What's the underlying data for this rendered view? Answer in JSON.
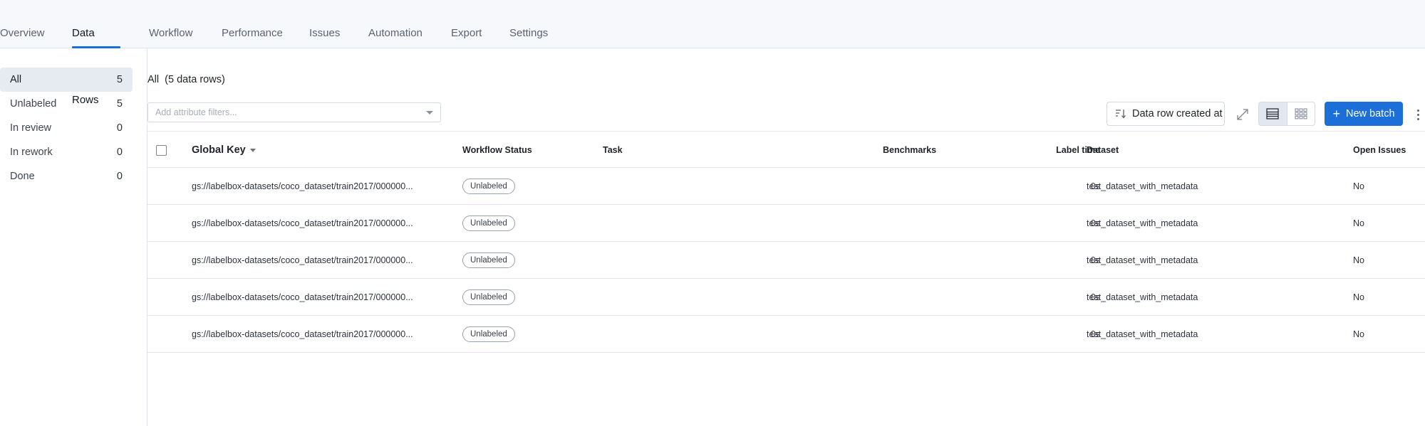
{
  "tabs": [
    {
      "label": "Overview",
      "active": false
    },
    {
      "label": "Data Rows",
      "active": true
    },
    {
      "label": "Workflow",
      "active": false
    },
    {
      "label": "Performance",
      "active": false
    },
    {
      "label": "Issues",
      "active": false
    },
    {
      "label": "Automation",
      "active": false
    },
    {
      "label": "Export",
      "active": false
    },
    {
      "label": "Settings",
      "active": false
    }
  ],
  "sidebar": {
    "items": [
      {
        "label": "All",
        "count": "5",
        "active": true
      },
      {
        "label": "Unlabeled",
        "count": "5",
        "active": false
      },
      {
        "label": "In review",
        "count": "0",
        "active": false
      },
      {
        "label": "In rework",
        "count": "0",
        "active": false
      },
      {
        "label": "Done",
        "count": "0",
        "active": false
      }
    ]
  },
  "main": {
    "heading": "All  (5 data rows)",
    "filter_placeholder": "Add attribute filters...",
    "sort_label": "Data row created at",
    "new_batch_label": "New batch"
  },
  "table": {
    "headers": {
      "global_key": "Global Key",
      "workflow_status": "Workflow Status",
      "task": "Task",
      "benchmarks": "Benchmarks",
      "label_time": "Label time",
      "dataset": "Dataset",
      "open_issues": "Open Issues"
    },
    "rows": [
      {
        "global_key": "gs://labelbox-datasets/coco_dataset/train2017/000000...",
        "status": "Unlabeled",
        "task": "",
        "benchmarks": "",
        "label_time": "0s",
        "dataset": "test_dataset_with_metadata",
        "open_issues": "No"
      },
      {
        "global_key": "gs://labelbox-datasets/coco_dataset/train2017/000000...",
        "status": "Unlabeled",
        "task": "",
        "benchmarks": "",
        "label_time": "0s",
        "dataset": "test_dataset_with_metadata",
        "open_issues": "No"
      },
      {
        "global_key": "gs://labelbox-datasets/coco_dataset/train2017/000000...",
        "status": "Unlabeled",
        "task": "",
        "benchmarks": "",
        "label_time": "0s",
        "dataset": "test_dataset_with_metadata",
        "open_issues": "No"
      },
      {
        "global_key": "gs://labelbox-datasets/coco_dataset/train2017/000000...",
        "status": "Unlabeled",
        "task": "",
        "benchmarks": "",
        "label_time": "0s",
        "dataset": "test_dataset_with_metadata",
        "open_issues": "No"
      },
      {
        "global_key": "gs://labelbox-datasets/coco_dataset/train2017/000000...",
        "status": "Unlabeled",
        "task": "",
        "benchmarks": "",
        "label_time": "0s",
        "dataset": "test_dataset_with_metadata",
        "open_issues": "No"
      }
    ]
  },
  "colors": {
    "accent": "#1c6ed8",
    "topbar_bg": "#f7f8fb",
    "sidebar_active_bg": "#e6eaf1"
  },
  "icons": {
    "sort": "sort-descending-icon",
    "expand": "expand-icon",
    "list_view": "list-view-icon",
    "grid_view": "grid-view-icon",
    "more": "kebab-menu-icon",
    "add": "plus-icon"
  }
}
